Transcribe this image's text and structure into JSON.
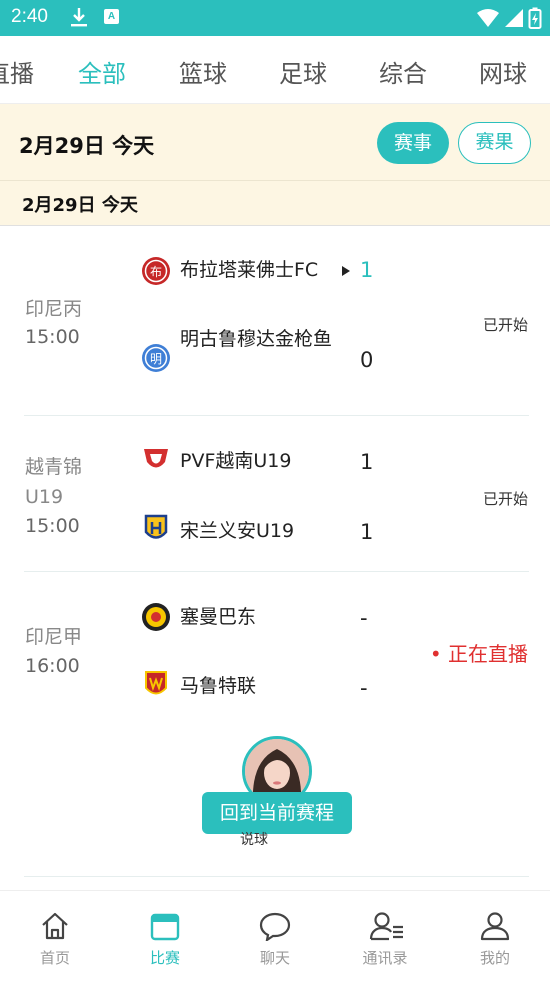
{
  "status_bar": {
    "time": "2:40",
    "a_badge": "A"
  },
  "tabs": [
    "直播",
    "全部",
    "篮球",
    "足球",
    "综合",
    "网球"
  ],
  "date_header": {
    "label": "2月29日 今天",
    "schedule_button": "赛事",
    "results_button": "赛果"
  },
  "sub_date": {
    "label": "2月29日  今天"
  },
  "matches": [
    {
      "league": "印尼丙",
      "time": "15:00",
      "status": "已开始",
      "home": {
        "name": "布拉塔莱佛士FC",
        "logo_char": "布",
        "score": "1"
      },
      "away": {
        "name": "明古鲁穆达金枪鱼",
        "logo_char": "明",
        "score": "0"
      }
    },
    {
      "league": "越青锦U19",
      "time": "15:00",
      "status": "已开始",
      "home": {
        "name": "PVF越南U19",
        "score": "1"
      },
      "away": {
        "name": "宋兰义安U19",
        "score": "1"
      }
    },
    {
      "league": "印尼甲",
      "time": "16:00",
      "status": "正在直播",
      "home": {
        "name": "塞曼巴东",
        "score": "-"
      },
      "away": {
        "name": "马鲁特联",
        "score": "-"
      }
    }
  ],
  "floating": {
    "back_button": "回到当前赛程",
    "caption": "说球"
  },
  "bottom_nav": [
    "首页",
    "比赛",
    "聊天",
    "通讯录",
    "我的"
  ],
  "colors": {
    "accent": "#2bbfbd",
    "live": "#e03030",
    "date_bg": "#fdf6e3"
  }
}
